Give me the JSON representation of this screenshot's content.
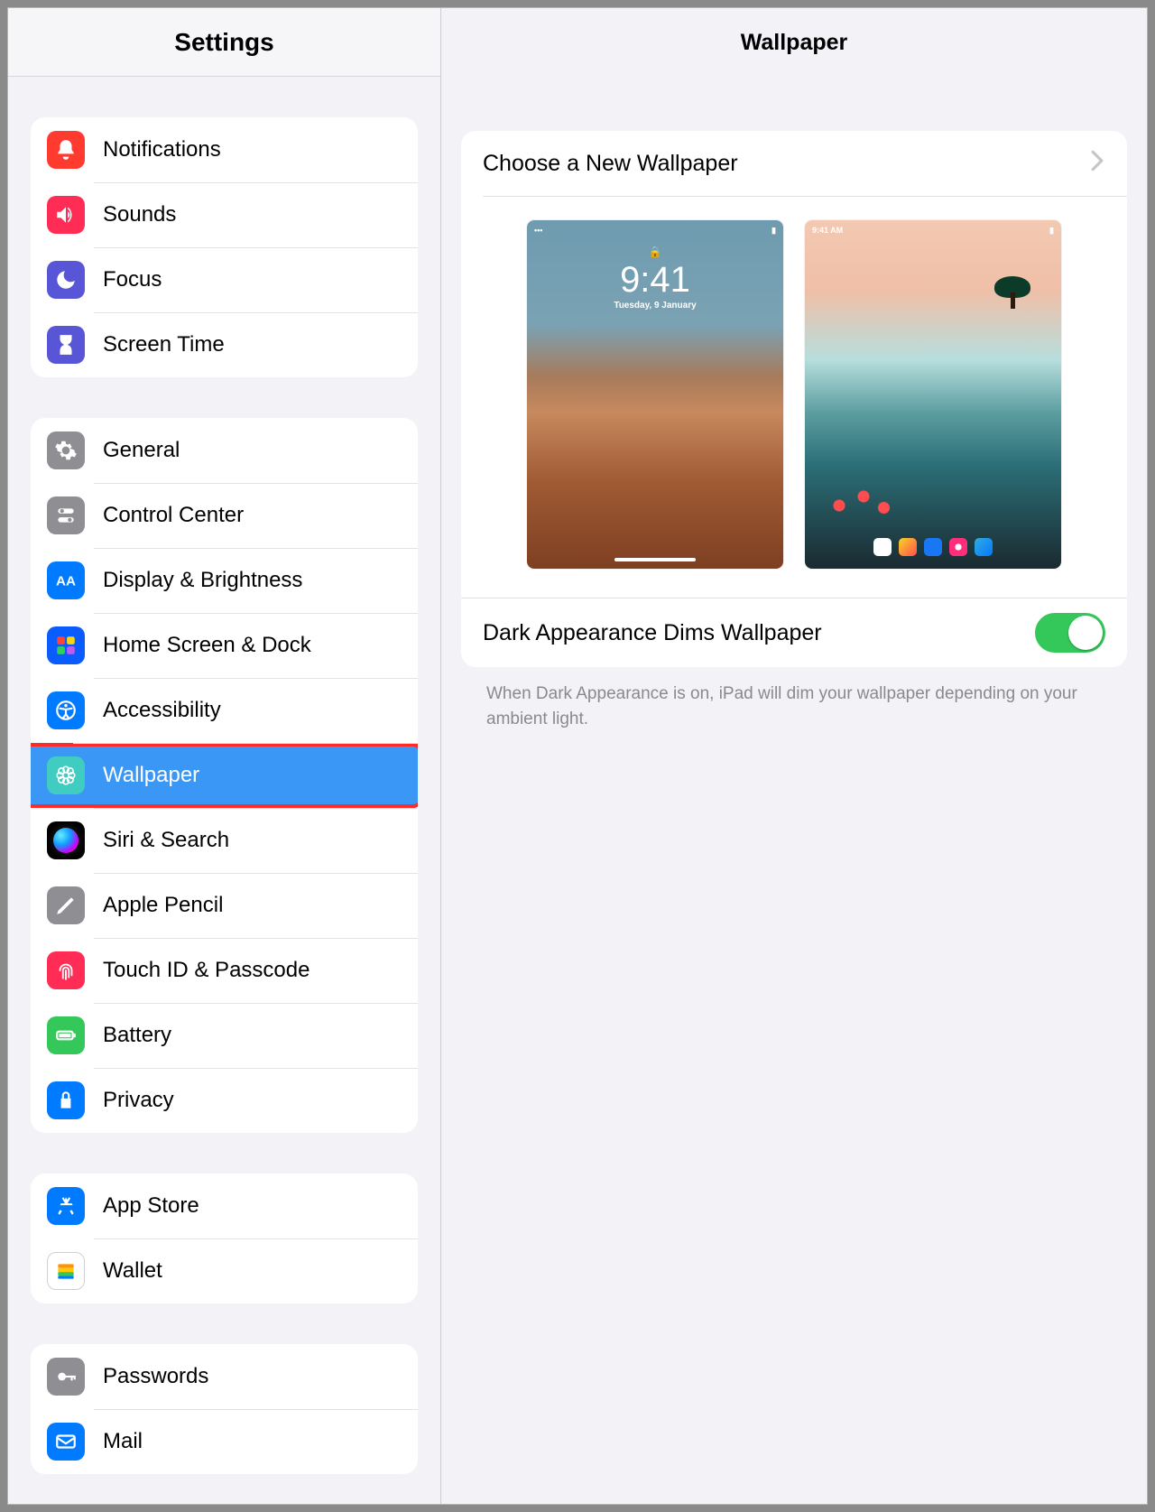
{
  "sidebar": {
    "title": "Settings",
    "groups": [
      {
        "rows": [
          {
            "id": "notifications",
            "label": "Notifications",
            "iconColor": "c-red"
          },
          {
            "id": "sounds",
            "label": "Sounds",
            "iconColor": "c-crimson"
          },
          {
            "id": "focus",
            "label": "Focus",
            "iconColor": "c-indigo"
          },
          {
            "id": "screen-time",
            "label": "Screen Time",
            "iconColor": "c-indigo"
          }
        ]
      },
      {
        "rows": [
          {
            "id": "general",
            "label": "General",
            "iconColor": "c-gray"
          },
          {
            "id": "control-center",
            "label": "Control Center",
            "iconColor": "c-gray"
          },
          {
            "id": "display",
            "label": "Display & Brightness",
            "iconColor": "c-blue"
          },
          {
            "id": "home-screen",
            "label": "Home Screen & Dock",
            "iconColor": "rainbow"
          },
          {
            "id": "accessibility",
            "label": "Accessibility",
            "iconColor": "c-blue"
          },
          {
            "id": "wallpaper",
            "label": "Wallpaper",
            "iconColor": "c-teal",
            "selected": true,
            "highlight": true
          },
          {
            "id": "siri",
            "label": "Siri & Search",
            "iconColor": "siri"
          },
          {
            "id": "apple-pencil",
            "label": "Apple Pencil",
            "iconColor": "c-gray"
          },
          {
            "id": "touchid",
            "label": "Touch ID & Passcode",
            "iconColor": "c-crimson"
          },
          {
            "id": "battery",
            "label": "Battery",
            "iconColor": "c-green"
          },
          {
            "id": "privacy",
            "label": "Privacy",
            "iconColor": "c-blue"
          }
        ]
      },
      {
        "rows": [
          {
            "id": "app-store",
            "label": "App Store",
            "iconColor": "c-blue"
          },
          {
            "id": "wallet",
            "label": "Wallet",
            "iconColor": "c-white"
          }
        ]
      },
      {
        "rows": [
          {
            "id": "passwords",
            "label": "Passwords",
            "iconColor": "c-gray"
          },
          {
            "id": "mail",
            "label": "Mail",
            "iconColor": "c-blue"
          }
        ]
      }
    ]
  },
  "main": {
    "title": "Wallpaper",
    "choose_label": "Choose a New Wallpaper",
    "lock_preview": {
      "time": "9:41",
      "date": "Tuesday, 9 January"
    },
    "dark_toggle_label": "Dark Appearance Dims Wallpaper",
    "dark_toggle_on": true,
    "footer": "When Dark Appearance is on, iPad will dim your wallpaper depending on your ambient light."
  }
}
